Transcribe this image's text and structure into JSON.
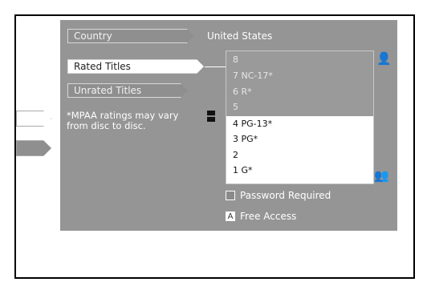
{
  "menu": {
    "country_label": "Country",
    "country_value": "United States",
    "rated_label": "Rated Titles",
    "unrated_label": "Unrated Titles"
  },
  "note": "*MPAA ratings may vary from disc to disc.",
  "ratings": [
    {
      "level": "8",
      "label": ""
    },
    {
      "level": "7",
      "label": "NC-17*"
    },
    {
      "level": "6",
      "label": "R*"
    },
    {
      "level": "5",
      "label": ""
    },
    {
      "level": "4",
      "label": "PG-13*"
    },
    {
      "level": "3",
      "label": "PG*"
    },
    {
      "level": "2",
      "label": ""
    },
    {
      "level": "1",
      "label": "G*"
    }
  ],
  "legend": {
    "password_label": "Password Required",
    "free_icon": "A",
    "free_label": "Free Access"
  },
  "icons": [
    "adult-icon",
    "family-icon",
    "lock-slider-icon"
  ]
}
